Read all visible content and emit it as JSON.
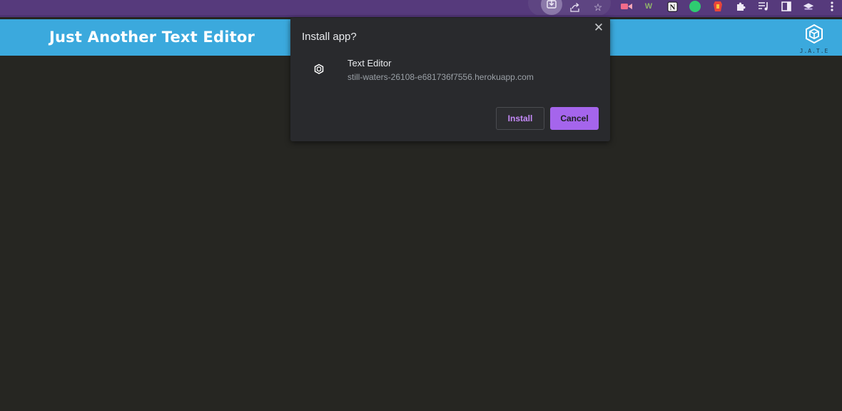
{
  "browser": {
    "toolbar_icons": [
      "install-icon",
      "share-icon",
      "bookmark-star-icon"
    ],
    "extensions": [
      {
        "name": "video-extension-icon",
        "color": "#f16b8a"
      },
      {
        "name": "w-extension-icon",
        "glyph": "W",
        "color": "#8fb36a"
      },
      {
        "name": "notion-icon",
        "glyph": "N",
        "color": "#ffffff"
      },
      {
        "name": "green-circle-extension-icon",
        "color": "#2ecc71"
      },
      {
        "name": "red-extension-icon",
        "color": "#e8463a"
      },
      {
        "name": "puzzle-extensions-icon"
      },
      {
        "name": "media-playlist-icon"
      },
      {
        "name": "side-panel-icon"
      },
      {
        "name": "profile-icon"
      },
      {
        "name": "more-menu-icon"
      }
    ],
    "colors": {
      "toolbar": "#563a7c",
      "active_button": "#8b78a9"
    }
  },
  "app": {
    "title": "Just Another Text Editor",
    "logo_label": "J.A.T.E",
    "header_color": "#3ba9dd",
    "editor_background": "#262622"
  },
  "dialog": {
    "title": "Install app?",
    "close_icon": "close-icon",
    "app_name": "Text Editor",
    "app_url": "still-waters-26108-e681736f7556.herokuapp.com",
    "install_label": "Install",
    "cancel_label": "Cancel",
    "accent_color": "#a565ec"
  }
}
